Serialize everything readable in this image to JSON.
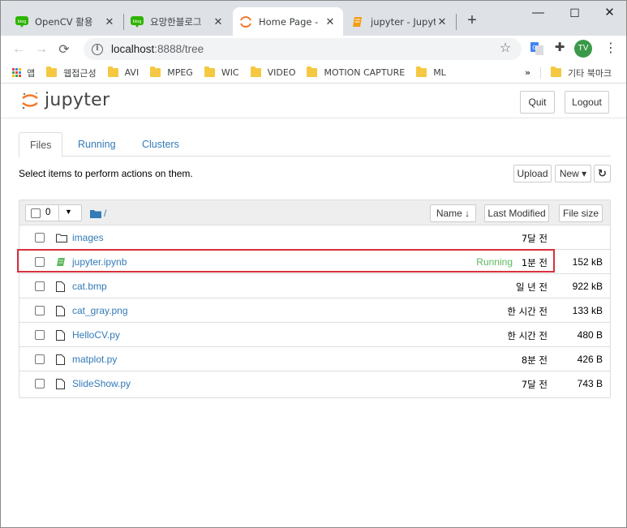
{
  "browser": {
    "tabs": [
      {
        "title": "OpenCV 활용",
        "icon": "naver-blog-icon",
        "active": false
      },
      {
        "title": "요망한블로그",
        "icon": "naver-blog-icon",
        "active": false
      },
      {
        "title": "Home Page - ",
        "icon": "jupyter-loading-icon",
        "active": true
      },
      {
        "title": "jupyter - Jupyt",
        "icon": "notebook-icon",
        "active": false
      }
    ],
    "new_tab": "+",
    "window_controls": {
      "minimize": "—",
      "maximize": "☐",
      "close": "✕"
    },
    "url_host": "localhost",
    "url_rest": ":8888/tree",
    "profile_initials": "TV",
    "bookmarks": [
      {
        "label": "앱",
        "type": "apps"
      },
      {
        "label": "웹접근성",
        "type": "folder"
      },
      {
        "label": "AVI",
        "type": "folder"
      },
      {
        "label": "MPEG",
        "type": "folder"
      },
      {
        "label": "WIC",
        "type": "folder"
      },
      {
        "label": "VIDEO",
        "type": "folder"
      },
      {
        "label": "MOTION CAPTURE",
        "type": "folder"
      },
      {
        "label": "ML",
        "type": "folder"
      }
    ],
    "bookmarks_more": "»",
    "other_bookmarks": "기타 북마크"
  },
  "jupyter": {
    "logo_text": "jupyter",
    "quit": "Quit",
    "logout": "Logout",
    "tabs": [
      "Files",
      "Running",
      "Clusters"
    ],
    "active_tab": "Files",
    "hint": "Select items to perform actions on them.",
    "upload": "Upload",
    "new": "New ▾",
    "refresh": "↻",
    "selected_count": "0",
    "breadcrumb": "/",
    "sort_name": "Name ↓",
    "col_modified": "Last Modified",
    "col_size": "File size",
    "files": [
      {
        "name": "images",
        "type": "folder",
        "status": "",
        "modified": "7달 전",
        "size": ""
      },
      {
        "name": "jupyter.ipynb",
        "type": "notebook",
        "status": "Running",
        "modified": "1분 전",
        "size": "152 kB"
      },
      {
        "name": "cat.bmp",
        "type": "file",
        "status": "",
        "modified": "일 년 전",
        "size": "922 kB"
      },
      {
        "name": "cat_gray.png",
        "type": "file",
        "status": "",
        "modified": "한 시간 전",
        "size": "133 kB"
      },
      {
        "name": "HelloCV.py",
        "type": "file",
        "status": "",
        "modified": "한 시간 전",
        "size": "480 B"
      },
      {
        "name": "matplot.py",
        "type": "file",
        "status": "",
        "modified": "8분 전",
        "size": "426 B"
      },
      {
        "name": "SlideShow.py",
        "type": "file",
        "status": "",
        "modified": "7달 전",
        "size": "743 B"
      }
    ]
  },
  "colors": {
    "link": "#337ab7",
    "running": "#5cb85c",
    "highlight": "#d9303e",
    "jupyter_orange": "#f37626",
    "profile": "#3a9a4a"
  }
}
